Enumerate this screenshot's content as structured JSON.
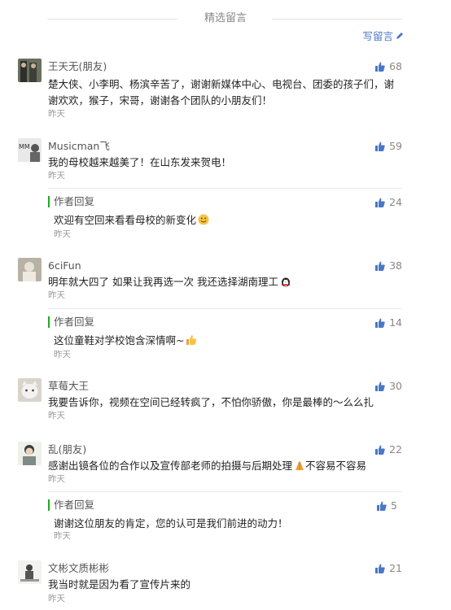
{
  "header": {
    "title": "精选留言",
    "write_label": "写留言"
  },
  "comments": [
    {
      "name": "王天无(朋友)",
      "text": "楚大侠、小李明、杨滨辛苦了，谢谢新媒体中心、电视台、团委的孩子们，谢谢欢欢，猴子，宋哥，谢谢各个团队的小朋友们！",
      "time": "昨天",
      "likes": "68"
    },
    {
      "name": "Musicman飞",
      "text": "我的母校越来越美了！在山东发来贺电！",
      "time": "昨天",
      "likes": "59",
      "reply": {
        "tag": "作者回复",
        "text": "欢迎有空回来看看母校的新变化",
        "time": "昨天",
        "likes": "24"
      }
    },
    {
      "name": "6ciFun",
      "text": "明年就大四了 如果让我再选一次 我还选择湖南理工",
      "time": "昨天",
      "likes": "38",
      "reply": {
        "tag": "作者回复",
        "text": "这位童鞋对学校饱含深情啊~",
        "time": "昨天",
        "likes": "14"
      }
    },
    {
      "name": "草莓大王",
      "text": "我要告诉你，视频在空间已经转疯了，不怕你骄傲，你是最棒的～么么扎",
      "time": "昨天",
      "likes": "30"
    },
    {
      "name": "乱(朋友)",
      "text": "感谢出镜各位的合作以及宣传部老师的拍摄与后期处理",
      "text_after": "不容易不容易",
      "time": "昨天",
      "likes": "22",
      "reply": {
        "tag": "作者回复",
        "text": "谢谢这位朋友的肯定，您的认可是我们前进的动力！",
        "time": "昨天",
        "likes": "5"
      }
    },
    {
      "name": "文彬文质彬彬",
      "text": "我当时就是因为看了宣传片来的",
      "time": "昨天",
      "likes": "21"
    }
  ],
  "colors": {
    "link": "#4a77c7",
    "reply_bar": "#1aad19",
    "thumb": "#4a77c7"
  }
}
